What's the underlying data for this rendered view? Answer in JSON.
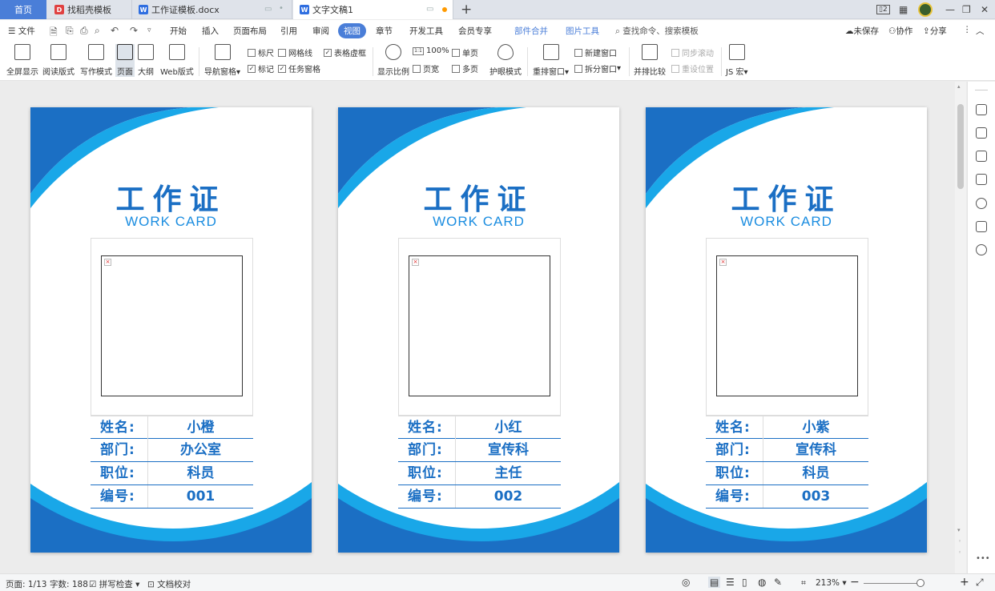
{
  "tabs": {
    "home": "首页",
    "docs": [
      {
        "label": "找稻壳模板",
        "icon": "docer-icon"
      },
      {
        "label": "工作证模板.docx",
        "icon": "wps-writer-icon"
      },
      {
        "label": "文字文稿1",
        "icon": "wps-writer-icon"
      }
    ],
    "window_badge": "2"
  },
  "menu": {
    "file": "文件",
    "items": [
      "开始",
      "插入",
      "页面布局",
      "引用",
      "审阅",
      "视图",
      "章节",
      "开发工具",
      "会员专享",
      "部件合并",
      "图片工具"
    ],
    "active": "视图",
    "search": "查找命令、搜索模板",
    "unsaved": "未保存",
    "collaborate": "协作",
    "share": "分享"
  },
  "ribbon": {
    "views": [
      "全屏显示",
      "阅读版式",
      "写作模式",
      "页面",
      "大纲",
      "Web版式"
    ],
    "nav_pane": "导航窗格",
    "checks": [
      {
        "label": "标尺",
        "checked": false
      },
      {
        "label": "网格线",
        "checked": false
      },
      {
        "label": "表格虚框",
        "checked": true
      },
      {
        "label": "标记",
        "checked": true
      },
      {
        "label": "任务窗格",
        "checked": true
      }
    ],
    "zoom_ratio": "显示比例",
    "zoom_100": "100%",
    "page_width": "页宽",
    "single_page": "单页",
    "multi_page": "多页",
    "eye_mode": "护眼模式",
    "rearrange": "重排窗口",
    "new_window": "新建窗口",
    "split_window": "拆分窗口",
    "side_compare": "并排比较",
    "sync_scroll": "同步滚动",
    "reset_pos": "重设位置",
    "js_macro": "JS 宏"
  },
  "cards": [
    {
      "title": "工作证",
      "subtitle": "WORK CARD",
      "rows": [
        {
          "label": "姓名:",
          "value": "小橙"
        },
        {
          "label": "部门:",
          "value": "办公室"
        },
        {
          "label": "职位:",
          "value": "科员"
        },
        {
          "label": "编号:",
          "value": "001"
        }
      ]
    },
    {
      "title": "工作证",
      "subtitle": "WORK CARD",
      "rows": [
        {
          "label": "姓名:",
          "value": "小红"
        },
        {
          "label": "部门:",
          "value": "宣传科"
        },
        {
          "label": "职位:",
          "value": "主任"
        },
        {
          "label": "编号:",
          "value": "002"
        }
      ]
    },
    {
      "title": "工作证",
      "subtitle": "WORK CARD",
      "rows": [
        {
          "label": "姓名:",
          "value": "小紫"
        },
        {
          "label": "部门:",
          "value": "宣传科"
        },
        {
          "label": "职位:",
          "value": "科员"
        },
        {
          "label": "编号:",
          "value": "003"
        }
      ]
    }
  ],
  "status": {
    "page": "页面: 1/13",
    "words": "字数: 188",
    "spell": "拼写检查",
    "proof": "文档校对",
    "zoom": "213%"
  },
  "colors": {
    "accent": "#4a7ed8",
    "card_blue": "#1b6fc4",
    "card_light": "#19a7e8"
  }
}
